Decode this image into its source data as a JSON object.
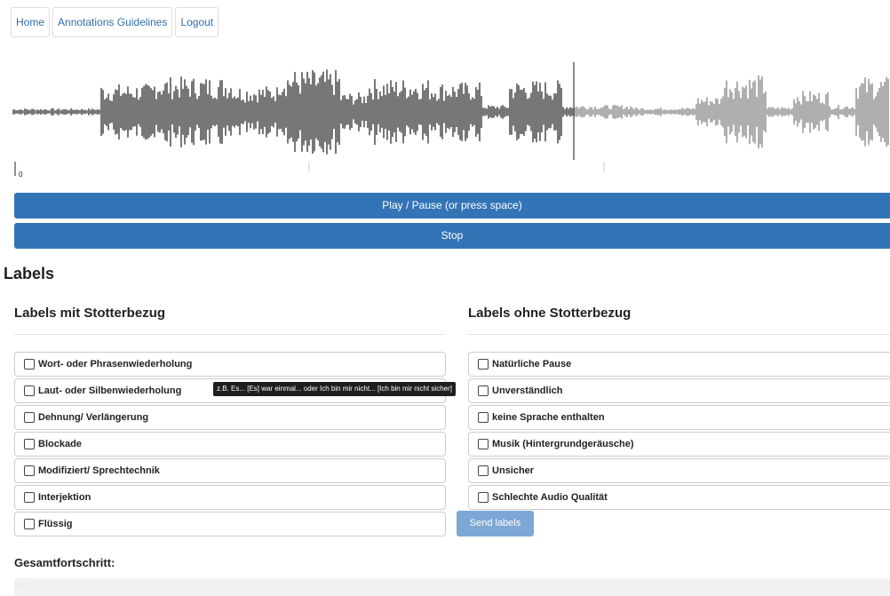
{
  "nav": {
    "home": "Home",
    "guidelines": "Annotations Guidelines",
    "logout": "Logout"
  },
  "waveform": {
    "time_label": "0",
    "played_color": "#555555",
    "unplayed_color": "#9b9b9b",
    "playhead_fraction": 0.64
  },
  "player": {
    "play_label": "Play / Pause (or press space)",
    "stop_label": "Stop"
  },
  "labels": {
    "heading": "Labels",
    "left_title": "Labels mit Stotterbezug",
    "right_title": "Labels ohne Stotterbezug",
    "left_items": [
      {
        "label": "Wort- oder Phrasenwiederholung",
        "checked": false
      },
      {
        "label": "Laut- oder Silbenwiederholung",
        "checked": false
      },
      {
        "label": "Dehnung/ Verlängerung",
        "checked": false
      },
      {
        "label": "Blockade",
        "checked": false
      },
      {
        "label": "Modifiziert/ Sprechtechnik",
        "checked": false
      },
      {
        "label": "Interjektion",
        "checked": false
      },
      {
        "label": "Flüssig",
        "checked": false
      }
    ],
    "right_items": [
      {
        "label": "Natürliche Pause",
        "checked": false
      },
      {
        "label": "Unverständlich",
        "checked": false
      },
      {
        "label": "keine Sprache enthalten",
        "checked": false
      },
      {
        "label": "Musik (Hintergrundgeräusche)",
        "checked": false
      },
      {
        "label": "Unsicher",
        "checked": false
      },
      {
        "label": "Schlechte Audio Qualität",
        "checked": false
      }
    ],
    "tooltip": "z.B. Es... [Es] war einmal... oder Ich bin mir nicht... [Ich bin mir nicht sicher]",
    "send_label": "Send labels"
  },
  "progress": {
    "title": "Gesamtfortschritt:",
    "value_text": "0%",
    "fraction": 0.0
  },
  "colors": {
    "primary": "#3374b6",
    "primary_disabled": "#7da7d4",
    "link": "#2f6fae"
  }
}
